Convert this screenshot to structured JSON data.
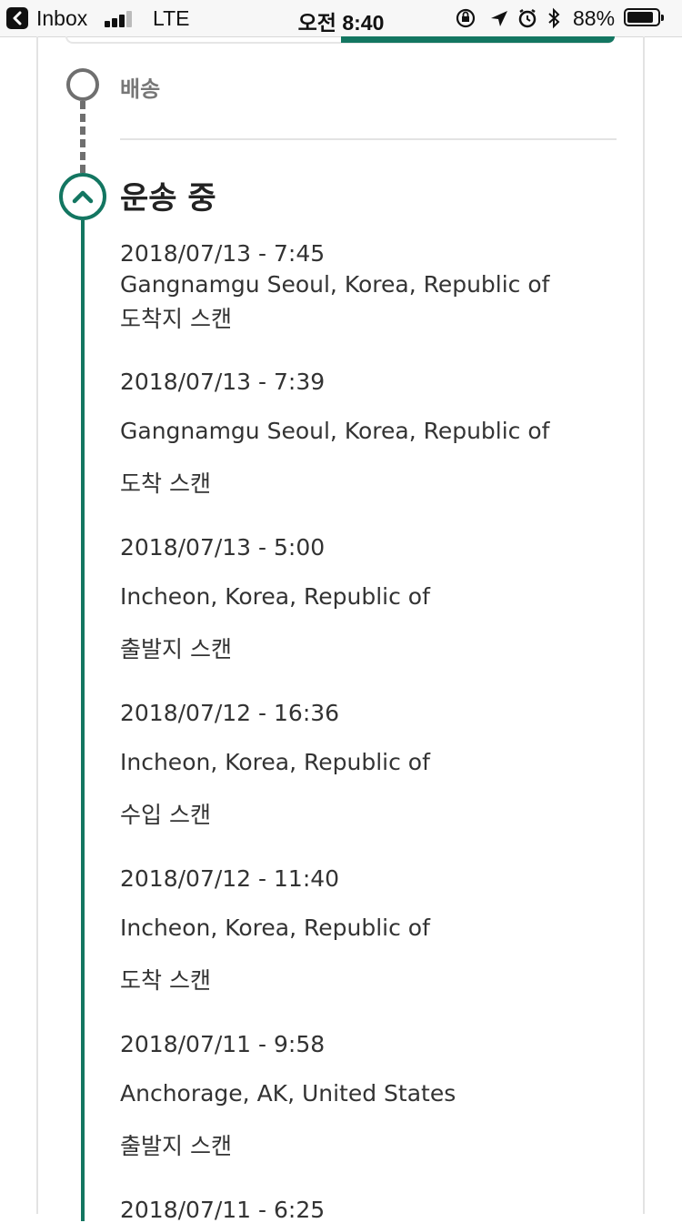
{
  "status_bar": {
    "back_app": "Inbox",
    "network": "LTE",
    "time": "오전 8:40",
    "battery": "88%",
    "battery_level": 0.88
  },
  "colors": {
    "accent": "#137661",
    "inactive": "#6f6f6f"
  },
  "timeline": {
    "done_stage": "배송",
    "current_stage": "운송 중",
    "events": [
      {
        "datetime": "2018/07/13 - 7:45",
        "location": "Gangnamgu Seoul, Korea, Republic of",
        "status": "도착지 스캔"
      },
      {
        "datetime": "2018/07/13 - 7:39",
        "location": "Gangnamgu Seoul, Korea, Republic of",
        "status": "도착 스캔"
      },
      {
        "datetime": "2018/07/13 - 5:00",
        "location": "Incheon, Korea, Republic of",
        "status": "출발지 스캔"
      },
      {
        "datetime": "2018/07/12 - 16:36",
        "location": "Incheon, Korea, Republic of",
        "status": "수입 스캔"
      },
      {
        "datetime": "2018/07/12 - 11:40",
        "location": "Incheon, Korea, Republic of",
        "status": "도착 스캔"
      },
      {
        "datetime": "2018/07/11 - 9:58",
        "location": "Anchorage, AK, United States",
        "status": "출발지 스캔"
      },
      {
        "datetime": "2018/07/11 - 6:25"
      }
    ]
  }
}
